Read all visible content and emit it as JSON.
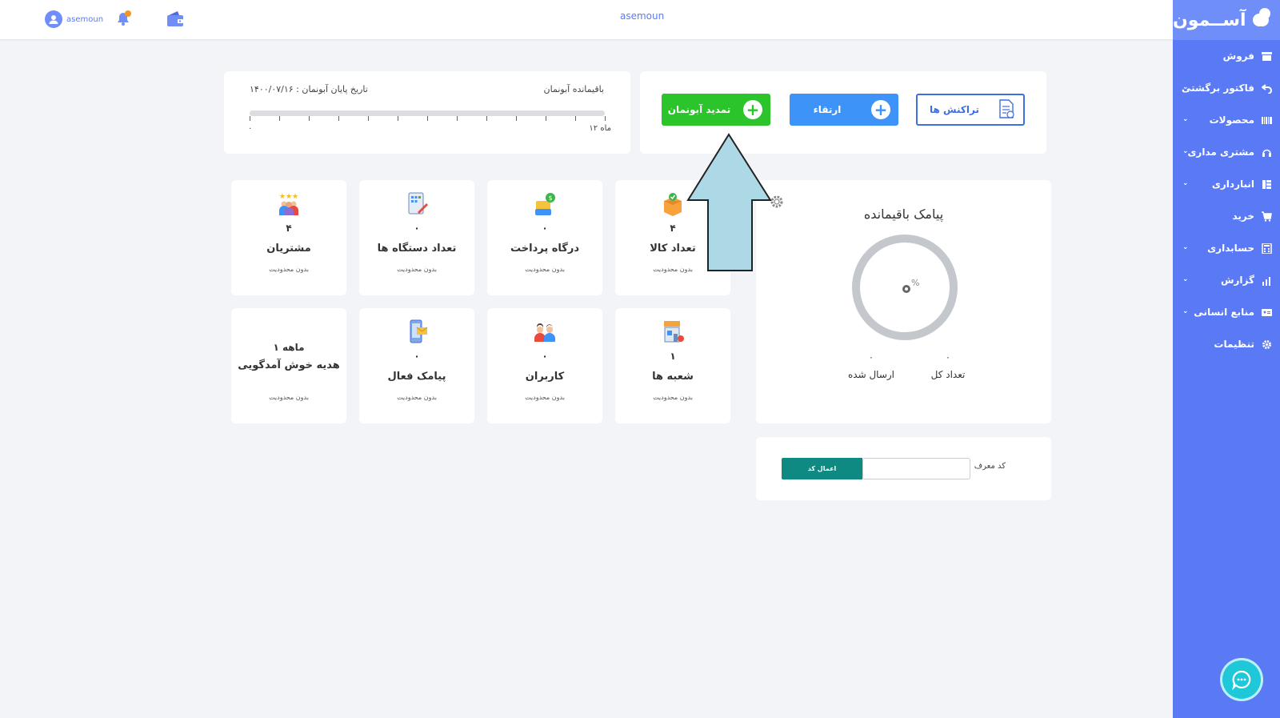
{
  "app": {
    "logo_text": "آســمون",
    "header_title": "asemoun",
    "username": "asemoun",
    "accent_color": "#5a7af5"
  },
  "sidebar": {
    "items": [
      {
        "label": "فروش",
        "icon": "store-icon",
        "has_submenu": false
      },
      {
        "label": "فاکتور برگشتی",
        "icon": "return-icon",
        "has_submenu": true
      },
      {
        "label": "محصولات",
        "icon": "barcode-icon",
        "has_submenu": true
      },
      {
        "label": "مشتری مداری",
        "icon": "headset-icon",
        "has_submenu": true
      },
      {
        "label": "انبارداری",
        "icon": "warehouse-icon",
        "has_submenu": true
      },
      {
        "label": "خرید",
        "icon": "cart-icon",
        "has_submenu": false
      },
      {
        "label": "حسابداری",
        "icon": "calculator-icon",
        "has_submenu": true
      },
      {
        "label": "گزارش",
        "icon": "chart-icon",
        "has_submenu": true
      },
      {
        "label": "منابع انسانی",
        "icon": "id-card-icon",
        "has_submenu": true
      },
      {
        "label": "تنظیمات",
        "icon": "gear-icon",
        "has_submenu": false
      }
    ]
  },
  "subscription": {
    "remaining_label": "باقیمانده آبونمان",
    "end_date": "تاریخ پایان آبونمان : ۱۴۰۰/۰۷/۱۶",
    "range_min": "۰",
    "range_max": "۱۲ ماه",
    "progress_fraction": 0
  },
  "actions": {
    "renew_label": "تمدید آبونمان",
    "upgrade_label": "ارتقاء",
    "transactions_label": "تراکنش ها"
  },
  "stats": [
    {
      "name": "products",
      "value": "۴",
      "label": "تعداد کالا",
      "note": "بدون محدودیت",
      "icon": "product-box-icon"
    },
    {
      "name": "payment-gateway",
      "value": "۰",
      "label": "درگاه پرداخت",
      "note": "بدون محدودیت",
      "icon": "payment-icon"
    },
    {
      "name": "devices",
      "value": "۰",
      "label": "تعداد دستگاه ها",
      "note": "بدون محدودیت",
      "icon": "device-icon"
    },
    {
      "name": "customers",
      "value": "۴",
      "label": "مشتریان",
      "note": "بدون محدودیت",
      "icon": "customers-icon"
    },
    {
      "name": "branches",
      "value": "۱",
      "label": "شعبه ها",
      "note": "بدون محدودیت",
      "icon": "branch-icon"
    },
    {
      "name": "users",
      "value": "۰",
      "label": "کاربران",
      "note": "بدون محدودیت",
      "icon": "users-icon"
    },
    {
      "name": "active-sms",
      "value": "۰",
      "label": "پیامک فعال",
      "note": "بدون محدودیت",
      "icon": "sms-phone-icon"
    },
    {
      "name": "welcome-gift",
      "value": "۱ ماهه",
      "label": "هدیه خوش آمدگویی",
      "note": "بدون محدودیت",
      "icon": ""
    }
  ],
  "sms": {
    "title": "پیامک باقیمانده",
    "percent_symbol": "%",
    "total_value": "۰",
    "total_label": "تعداد کل",
    "sent_value": "۰",
    "sent_label": "ارسال شده"
  },
  "referral": {
    "label": "کد معرف",
    "input_value": "",
    "apply_label": "اعمال کد"
  }
}
